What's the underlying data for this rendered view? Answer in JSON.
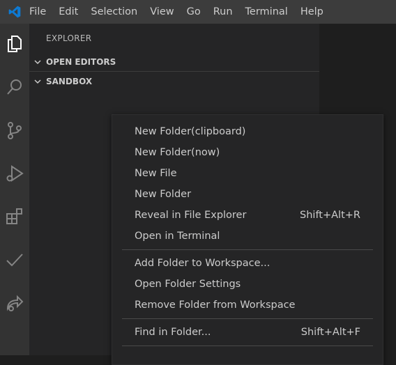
{
  "menubar": {
    "items": [
      "File",
      "Edit",
      "Selection",
      "View",
      "Go",
      "Run",
      "Terminal",
      "Help"
    ]
  },
  "activity_bar": {
    "icons": [
      "explorer-icon",
      "search-icon",
      "source-control-icon",
      "run-debug-icon",
      "extensions-icon",
      "check-icon",
      "remote-icon"
    ]
  },
  "sidebar": {
    "title": "EXPLORER",
    "sections": [
      {
        "label": "OPEN EDITORS"
      },
      {
        "label": "SANDBOX"
      }
    ]
  },
  "context_menu": {
    "groups": [
      [
        {
          "label": "New Folder(clipboard)",
          "shortcut": ""
        },
        {
          "label": "New Folder(now)",
          "shortcut": ""
        },
        {
          "label": "New File",
          "shortcut": ""
        },
        {
          "label": "New Folder",
          "shortcut": ""
        },
        {
          "label": "Reveal in File Explorer",
          "shortcut": "Shift+Alt+R"
        },
        {
          "label": "Open in Terminal",
          "shortcut": ""
        }
      ],
      [
        {
          "label": "Add Folder to Workspace...",
          "shortcut": ""
        },
        {
          "label": "Open Folder Settings",
          "shortcut": ""
        },
        {
          "label": "Remove Folder from Workspace",
          "shortcut": ""
        }
      ],
      [
        {
          "label": "Find in Folder...",
          "shortcut": "Shift+Alt+F"
        }
      ]
    ]
  },
  "colors": {
    "titlebar_bg": "#3c3c3c",
    "activitybar_bg": "#333333",
    "sidebar_bg": "#252526",
    "editor_bg": "#1e1e1e",
    "logo_blue": "#0e7ad3"
  }
}
